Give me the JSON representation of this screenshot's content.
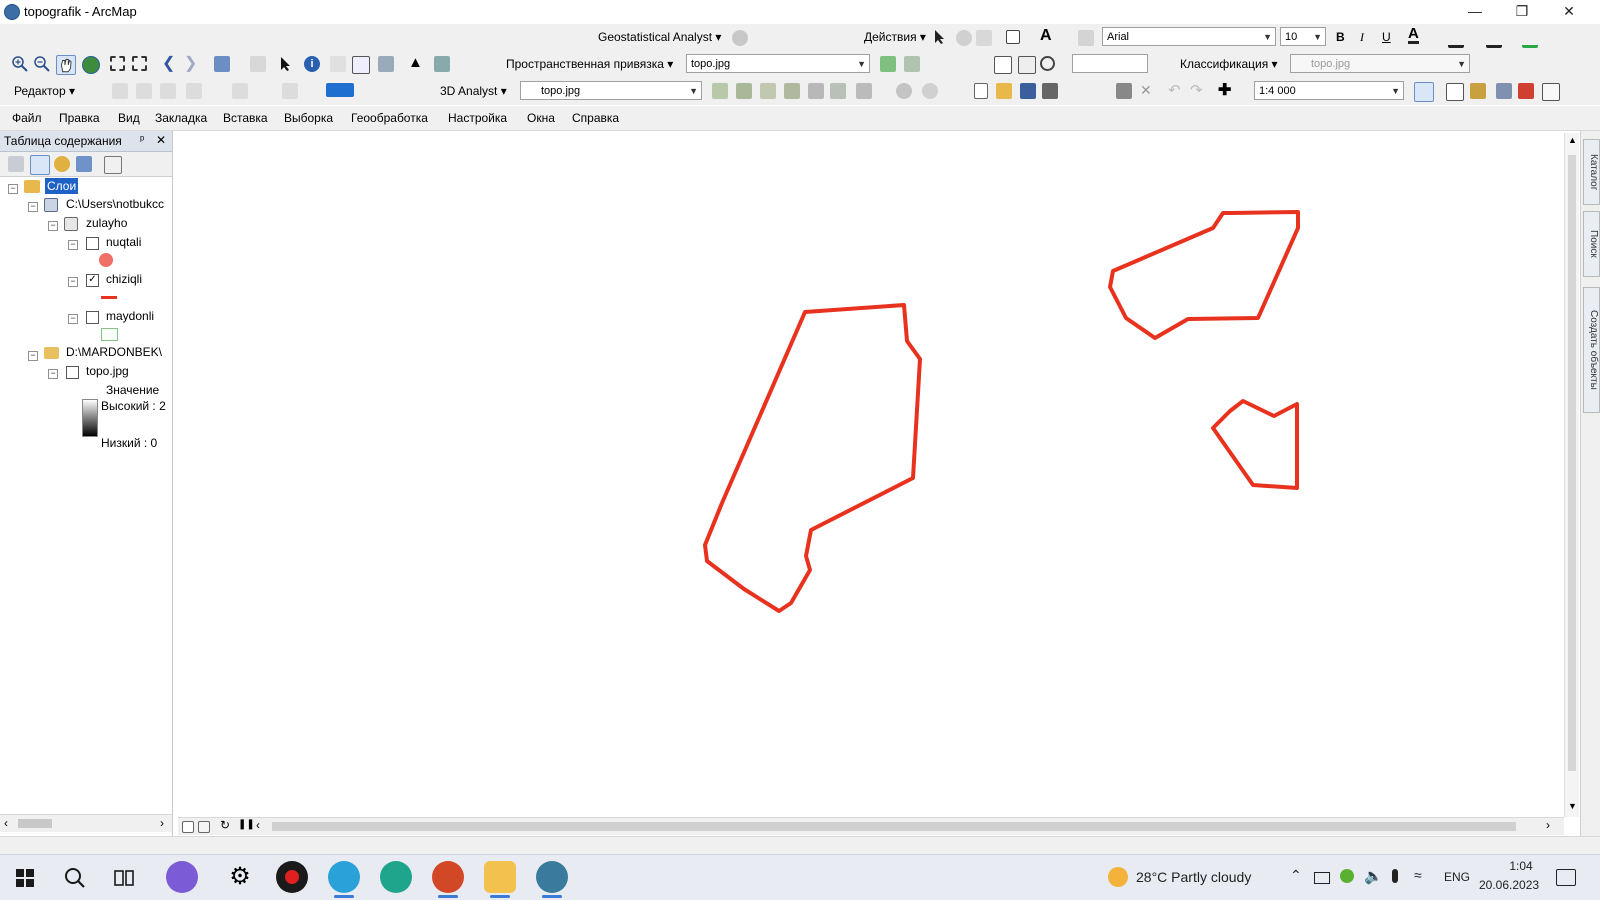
{
  "window": {
    "title": "topografik - ArcMap"
  },
  "toolbar_row1": {
    "geostat_label": "Geostatistical Analyst ▾",
    "actions_label": "Действия ▾",
    "font_name": "Arial",
    "font_size": "10",
    "bold": "B",
    "italic": "I",
    "underline": "U",
    "text_a": "A"
  },
  "toolbar_row2": {
    "spatial_ref_label": "Пространственная привязка ▾",
    "spatial_ref_layer": "topo.jpg",
    "classification_label": "Классификация ▾",
    "classification_layer": "topo.jpg"
  },
  "toolbar_row3": {
    "editor_label": "Редактор ▾",
    "analyst3d_label": "3D Analyst ▾",
    "analyst3d_layer": "topo.jpg",
    "scale": "1:4 000"
  },
  "menu": [
    "Файл",
    "Правка",
    "Вид",
    "Закладка",
    "Вставка",
    "Выборка",
    "Геообработка",
    "Настройка",
    "Окна",
    "Справка"
  ],
  "toc": {
    "title": "Таблица содержания",
    "pin": "ᵖ",
    "close": "✕",
    "root": "Слои",
    "folder1": "C:\\Users\\notbukcc",
    "group": "zulayho",
    "layers": [
      {
        "name": "nuqtali",
        "checked": false
      },
      {
        "name": "chiziqli",
        "checked": true
      },
      {
        "name": "maydonli",
        "checked": false
      }
    ],
    "folder2": "D:\\MARDONBEK\\",
    "raster": "topo.jpg",
    "value_label": "Значение",
    "high_label": "Высокий : 2",
    "low_label": "Низкий : 0"
  },
  "right_dock": [
    "Каталог",
    "Поиск",
    "Создать объекты"
  ],
  "map": {
    "line_color": "#e8321e"
  },
  "taskbar": {
    "weather": "28°C  Partly cloudy",
    "lang": "ENG",
    "time": "1:04",
    "date": "20.06.2023"
  }
}
